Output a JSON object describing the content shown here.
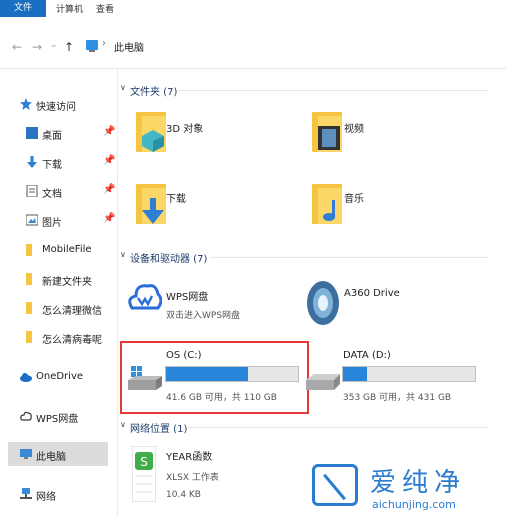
{
  "ribbon": {
    "file_tab": "文件",
    "tabs": [
      "计算机",
      "查看"
    ]
  },
  "address": {
    "back": "←",
    "forward": "→",
    "recent": "⌄",
    "up": "↑",
    "chevron": "›",
    "crumb": "此电脑"
  },
  "sidebar": {
    "quick_access": "快速访问",
    "items": [
      {
        "label": "桌面",
        "pin": "📌"
      },
      {
        "label": "下载",
        "pin": "📌"
      },
      {
        "label": "文档",
        "pin": "📌"
      },
      {
        "label": "图片",
        "pin": "📌"
      },
      {
        "label": "MobileFile"
      },
      {
        "label": "新建文件夹"
      },
      {
        "label": "怎么清理微信"
      },
      {
        "label": "怎么清病毒呢"
      }
    ],
    "onedrive": "OneDrive",
    "wps": "WPS网盘",
    "this_pc": "此电脑",
    "network": "网络"
  },
  "sections": {
    "folders": "文件夹 (7)",
    "devices": "设备和驱动器 (7)",
    "network": "网络位置 (1)"
  },
  "folders": [
    {
      "name": "3D 对象",
      "icon": "3d-objects-icon"
    },
    {
      "name": "视频",
      "icon": "video-folder-icon"
    },
    {
      "name": "下载",
      "icon": "download-folder-icon"
    },
    {
      "name": "音乐",
      "icon": "music-folder-icon"
    }
  ],
  "devices": {
    "wps": {
      "name": "WPS网盘",
      "sub": "双击进入WPS网盘"
    },
    "a360": {
      "name": "A360 Drive"
    },
    "os": {
      "name": "OS (C:)",
      "space": "41.6 GB 可用，共 110 GB",
      "used_fraction": 0.62
    },
    "data": {
      "name": "DATA (D:)",
      "space": "353 GB 可用，共 431 GB",
      "used_fraction": 0.18
    }
  },
  "network_item": {
    "name": "YEAR函数",
    "type": "XLSX 工作表",
    "size": "10.4 KB"
  },
  "watermark": {
    "cn": "爱纯净",
    "url": "aichunjing.com"
  },
  "colors": {
    "accent": "#2885d9",
    "highlight": "#e53935",
    "folder": "#f5c542"
  }
}
